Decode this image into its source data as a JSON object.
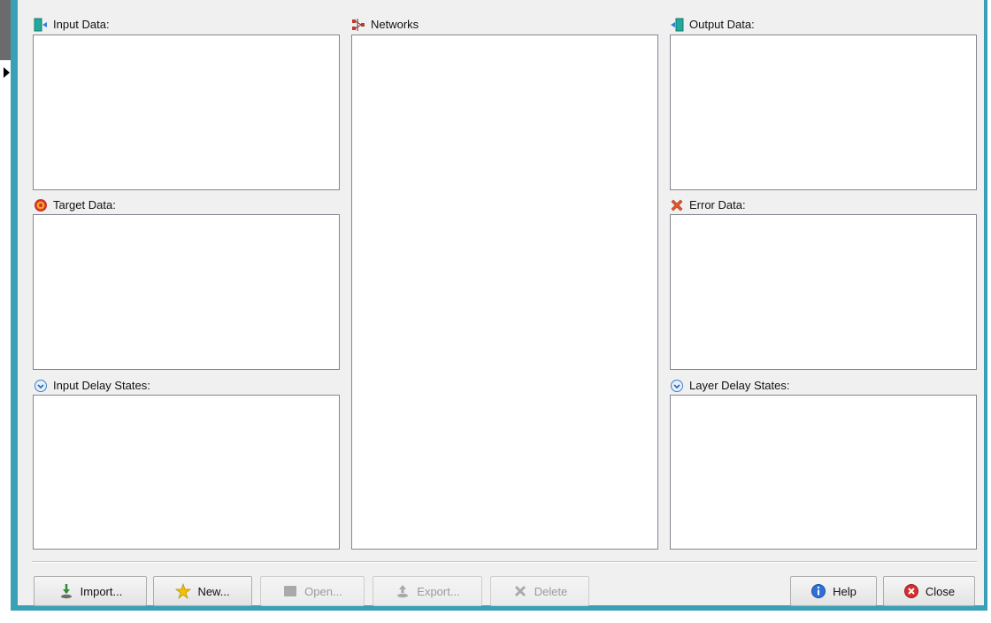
{
  "panels": {
    "input_data": {
      "label": "Input Data:",
      "icon": "input-data-icon"
    },
    "target_data": {
      "label": "Target Data:",
      "icon": "target-icon"
    },
    "input_delay_states": {
      "label": "Input Delay States:",
      "icon": "delay-states-icon"
    },
    "networks": {
      "label": "Networks",
      "icon": "network-icon"
    },
    "output_data": {
      "label": "Output Data:",
      "icon": "output-data-icon"
    },
    "error_data": {
      "label": "Error Data:",
      "icon": "error-icon"
    },
    "layer_delay_states": {
      "label": "Layer Delay States:",
      "icon": "delay-states-icon"
    }
  },
  "buttons": {
    "import": {
      "label": "Import...",
      "enabled": true
    },
    "new": {
      "label": "New...",
      "enabled": true
    },
    "open": {
      "label": "Open...",
      "enabled": false
    },
    "export": {
      "label": "Export...",
      "enabled": false
    },
    "delete": {
      "label": "Delete",
      "enabled": false
    },
    "help": {
      "label": "Help",
      "enabled": true
    },
    "close": {
      "label": "Close",
      "enabled": true
    }
  },
  "colors": {
    "window_border": "#3aa0b8",
    "dialog_background": "#f0f0f0",
    "list_border": "#828790",
    "close_red": "#d32f2f",
    "help_blue": "#2f6fd8"
  }
}
